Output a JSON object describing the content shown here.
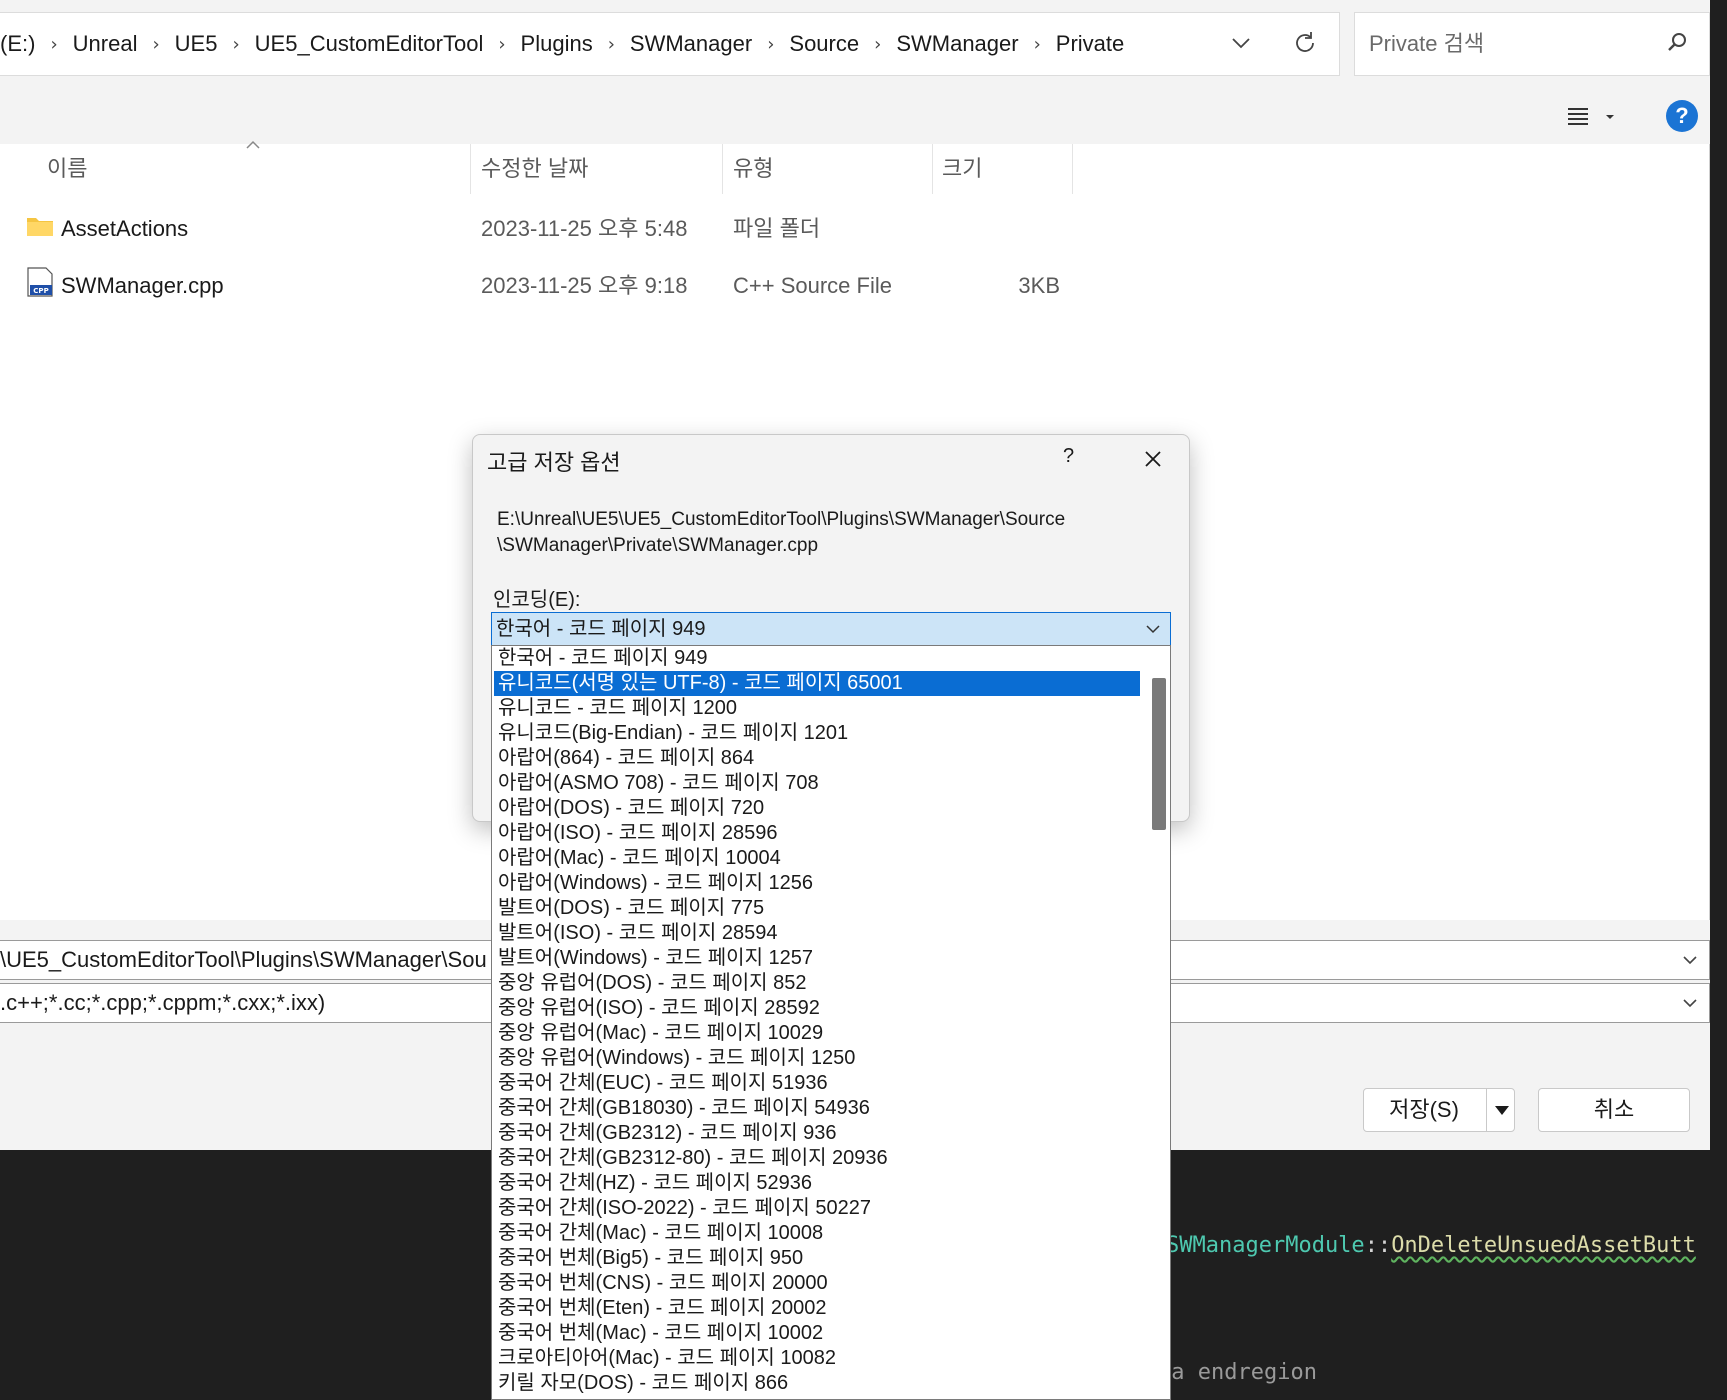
{
  "breadcrumb": {
    "items": [
      "(E:)",
      "Unreal",
      "UE5",
      "UE5_CustomEditorTool",
      "Plugins",
      "SWManager",
      "Source",
      "SWManager",
      "Private"
    ]
  },
  "search": {
    "placeholder": "Private 검색"
  },
  "columns": {
    "name": "이름",
    "date": "수정한 날짜",
    "type": "유형",
    "size": "크기"
  },
  "files": [
    {
      "name": "AssetActions",
      "date": "2023-11-25 오후 5:48",
      "type": "파일 폴더",
      "size": "",
      "icon": "folder-icon"
    },
    {
      "name": "SWManager.cpp",
      "date": "2023-11-25 오후 9:18",
      "type": "C++ Source File",
      "size": "3KB",
      "icon": "cpp-file-icon"
    }
  ],
  "filename_field": {
    "value": "\\UE5_CustomEditorTool\\Plugins\\SWManager\\Sou"
  },
  "filetype_field": {
    "value": ".c++;*.cc;*.cpp;*.cppm;*.cxx;*.ixx)"
  },
  "buttons": {
    "save": "저장(S)",
    "cancel": "취소"
  },
  "advanced_dialog": {
    "title": "고급 저장 옵션",
    "help": "?",
    "path_line1": "E:\\Unreal\\UE5\\UE5_CustomEditorTool\\Plugins\\SWManager\\Source",
    "path_line2": "\\SWManager\\Private\\SWManager.cpp",
    "encoding_label": "인코딩(E):",
    "encoding_selected": "한국어 - 코드 페이지 949",
    "encoding_options": [
      "한국어 - 코드 페이지 949",
      "유니코드(서명 있는 UTF-8) - 코드 페이지 65001",
      "유니코드 - 코드 페이지 1200",
      "유니코드(Big-Endian) - 코드 페이지 1201",
      "아랍어(864) - 코드 페이지 864",
      "아랍어(ASMO 708) - 코드 페이지 708",
      "아랍어(DOS) - 코드 페이지 720",
      "아랍어(ISO) - 코드 페이지 28596",
      "아랍어(Mac) - 코드 페이지 10004",
      "아랍어(Windows) - 코드 페이지 1256",
      "발트어(DOS) - 코드 페이지 775",
      "발트어(ISO) - 코드 페이지 28594",
      "발트어(Windows) - 코드 페이지 1257",
      "중앙 유럽어(DOS) - 코드 페이지 852",
      "중앙 유럽어(ISO) - 코드 페이지 28592",
      "중앙 유럽어(Mac) - 코드 페이지 10029",
      "중앙 유럽어(Windows) - 코드 페이지 1250",
      "중국어 간체(EUC) - 코드 페이지 51936",
      "중국어 간체(GB18030) - 코드 페이지 54936",
      "중국어 간체(GB2312) - 코드 페이지 936",
      "중국어 간체(GB2312-80) - 코드 페이지 20936",
      "중국어 간체(HZ) - 코드 페이지 52936",
      "중국어 간체(ISO-2022) - 코드 페이지 50227",
      "중국어 간체(Mac) - 코드 페이지 10008",
      "중국어 번체(Big5) - 코드 페이지 950",
      "중국어 번체(CNS) - 코드 페이지 20000",
      "중국어 번체(Eten) - 코드 페이지 20002",
      "중국어 번체(Mac) - 코드 페이지 10002",
      "크로아티아어(Mac) - 코드 페이지 10082",
      "키릴 자모(DOS) - 코드 페이지 866"
    ],
    "highlighted_index": 1
  },
  "editor": {
    "code_class": "SWManagerModule",
    "code_sep": "::",
    "code_fn": "OnDeleteUnsuedAssetButt",
    "code_line2": "ma endregion"
  },
  "colors": {
    "accent": "#0a6dd3",
    "selection_bg": "#cce4f7",
    "help_blue": "#1b74d4"
  }
}
